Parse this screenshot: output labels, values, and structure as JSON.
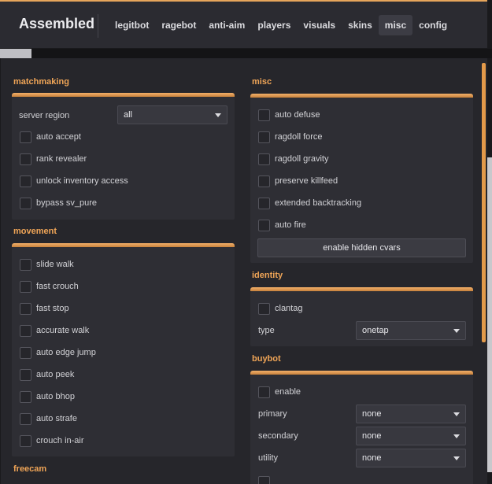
{
  "app": {
    "title": "Assembled"
  },
  "tabs": [
    "legitbot",
    "ragebot",
    "anti-aim",
    "players",
    "visuals",
    "skins",
    "misc",
    "config"
  ],
  "active_tab": "misc",
  "matchmaking": {
    "title": "matchmaking",
    "server_region_label": "server region",
    "server_region_value": "all",
    "checkboxes": [
      "auto accept",
      "rank revealer",
      "unlock inventory access",
      "bypass sv_pure"
    ]
  },
  "movement": {
    "title": "movement",
    "checkboxes": [
      "slide walk",
      "fast crouch",
      "fast stop",
      "accurate walk",
      "auto edge jump",
      "auto peek",
      "auto bhop",
      "auto strafe",
      "crouch in-air"
    ]
  },
  "freecam": {
    "title": "freecam"
  },
  "misc": {
    "title": "misc",
    "checkboxes": [
      "auto defuse",
      "ragdoll force",
      "ragdoll gravity",
      "preserve killfeed",
      "extended backtracking",
      "auto fire"
    ],
    "hidden_cvars_button": "enable hidden cvars"
  },
  "identity": {
    "title": "identity",
    "clantag_label": "clantag",
    "type_label": "type",
    "type_value": "onetap"
  },
  "buybot": {
    "title": "buybot",
    "enable_label": "enable",
    "primary_label": "primary",
    "primary_value": "none",
    "secondary_label": "secondary",
    "secondary_value": "none",
    "utility_label": "utility",
    "utility_value": "none"
  },
  "colors": {
    "accent": "#e6a55b",
    "background": "#26262b",
    "panel": "#2e2e34"
  }
}
